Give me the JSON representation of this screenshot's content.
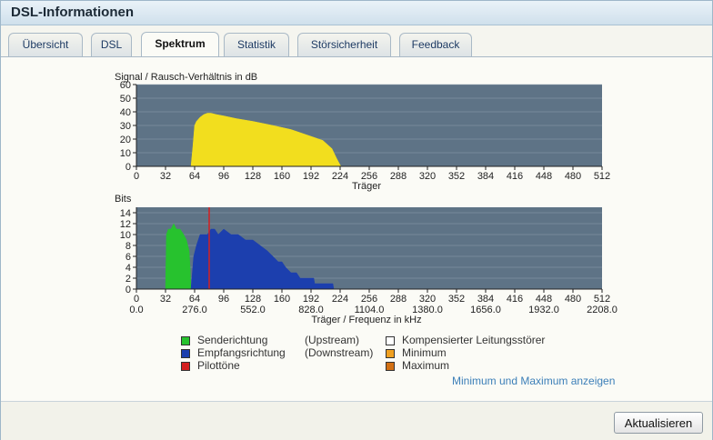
{
  "window": {
    "title": "DSL-Informationen"
  },
  "tabs": [
    {
      "label": "Übersicht"
    },
    {
      "label": "DSL"
    },
    {
      "label": "Spektrum"
    },
    {
      "label": "Statistik"
    },
    {
      "label": "Störsicherheit"
    },
    {
      "label": "Feedback"
    }
  ],
  "active_tab": "Spektrum",
  "chart_data": [
    {
      "type": "area",
      "ylabel": "Signal / Rausch-Verhältnis in dB",
      "xlabel": "Träger",
      "xlim": [
        0,
        512
      ],
      "ylim": [
        0,
        60
      ],
      "x_ticks": [
        "0",
        "32",
        "64",
        "96",
        "128",
        "160",
        "192",
        "224",
        "256",
        "288",
        "320",
        "352",
        "384",
        "416",
        "448",
        "480",
        "512"
      ],
      "y_ticks": [
        "0",
        "10",
        "20",
        "30",
        "40",
        "50",
        "60"
      ],
      "grid": true,
      "series": [
        {
          "color": "#f2de1e",
          "x": [
            60,
            62,
            64,
            66,
            70,
            74,
            78,
            82,
            88,
            96,
            110,
            128,
            150,
            170,
            192,
            205,
            215,
            220,
            224,
            225
          ],
          "y": [
            0,
            14,
            30,
            33,
            36,
            38,
            39,
            39,
            38,
            37,
            35,
            33,
            30,
            27,
            22,
            19,
            13,
            6,
            1,
            0
          ]
        }
      ]
    },
    {
      "type": "area",
      "ylabel": "Bits",
      "xlabel": "Träger / Frequenz in kHz",
      "xlim": [
        0,
        512
      ],
      "ylim": [
        0,
        15
      ],
      "x_ticks": [
        "0",
        "32",
        "64",
        "96",
        "128",
        "160",
        "192",
        "224",
        "256",
        "288",
        "320",
        "352",
        "384",
        "416",
        "448",
        "480",
        "512"
      ],
      "x_ticks_khz": [
        "0.0",
        "276.0",
        "552.0",
        "828.0",
        "1104.0",
        "1380.0",
        "1656.0",
        "1932.0",
        "2208.0"
      ],
      "y_ticks": [
        "0",
        "2",
        "4",
        "6",
        "8",
        "10",
        "12",
        "14"
      ],
      "grid": true,
      "pilot_tone": 80,
      "pilot_color": "#d42020",
      "series": [
        {
          "name": "Senderichtung",
          "color": "#27c22e",
          "x": [
            32,
            33,
            35,
            38,
            41,
            44,
            48,
            52,
            55,
            58,
            59,
            60
          ],
          "y": [
            0,
            10,
            11,
            11,
            12,
            11,
            11,
            10,
            9,
            7,
            4,
            0
          ]
        },
        {
          "name": "Empfangsrichtung",
          "color": "#1c3fae",
          "x": [
            60,
            61,
            63,
            66,
            70,
            74,
            78,
            82,
            86,
            90,
            96,
            104,
            112,
            120,
            128,
            136,
            144,
            150,
            156,
            160,
            164,
            170,
            176,
            180,
            192,
            195,
            196,
            200,
            215,
            216,
            217
          ],
          "y": [
            0,
            2,
            6,
            8,
            10,
            10,
            10,
            11,
            11,
            10,
            11,
            10,
            10,
            9,
            9,
            8,
            7,
            6,
            5,
            5,
            4,
            3,
            3,
            2,
            2,
            2,
            1,
            1,
            1,
            1,
            0
          ]
        }
      ]
    }
  ],
  "legend": [
    {
      "label": "Senderichtung",
      "direction": "(Upstream)",
      "color": "#27c22e"
    },
    {
      "label": "Empfangsrichtung",
      "direction": "(Downstream)",
      "color": "#1c3fae"
    },
    {
      "label": "Pilottöne",
      "color": "#d42020"
    },
    {
      "label": "Kompensierter Leitungsstörer",
      "color": "#ffffff"
    },
    {
      "label": "Minimum",
      "color": "#f0a020"
    },
    {
      "label": "Maximum",
      "color": "#d27014"
    }
  ],
  "link_show_minmax": "Minimum und Maximum anzeigen",
  "button_update": "Aktualisieren"
}
